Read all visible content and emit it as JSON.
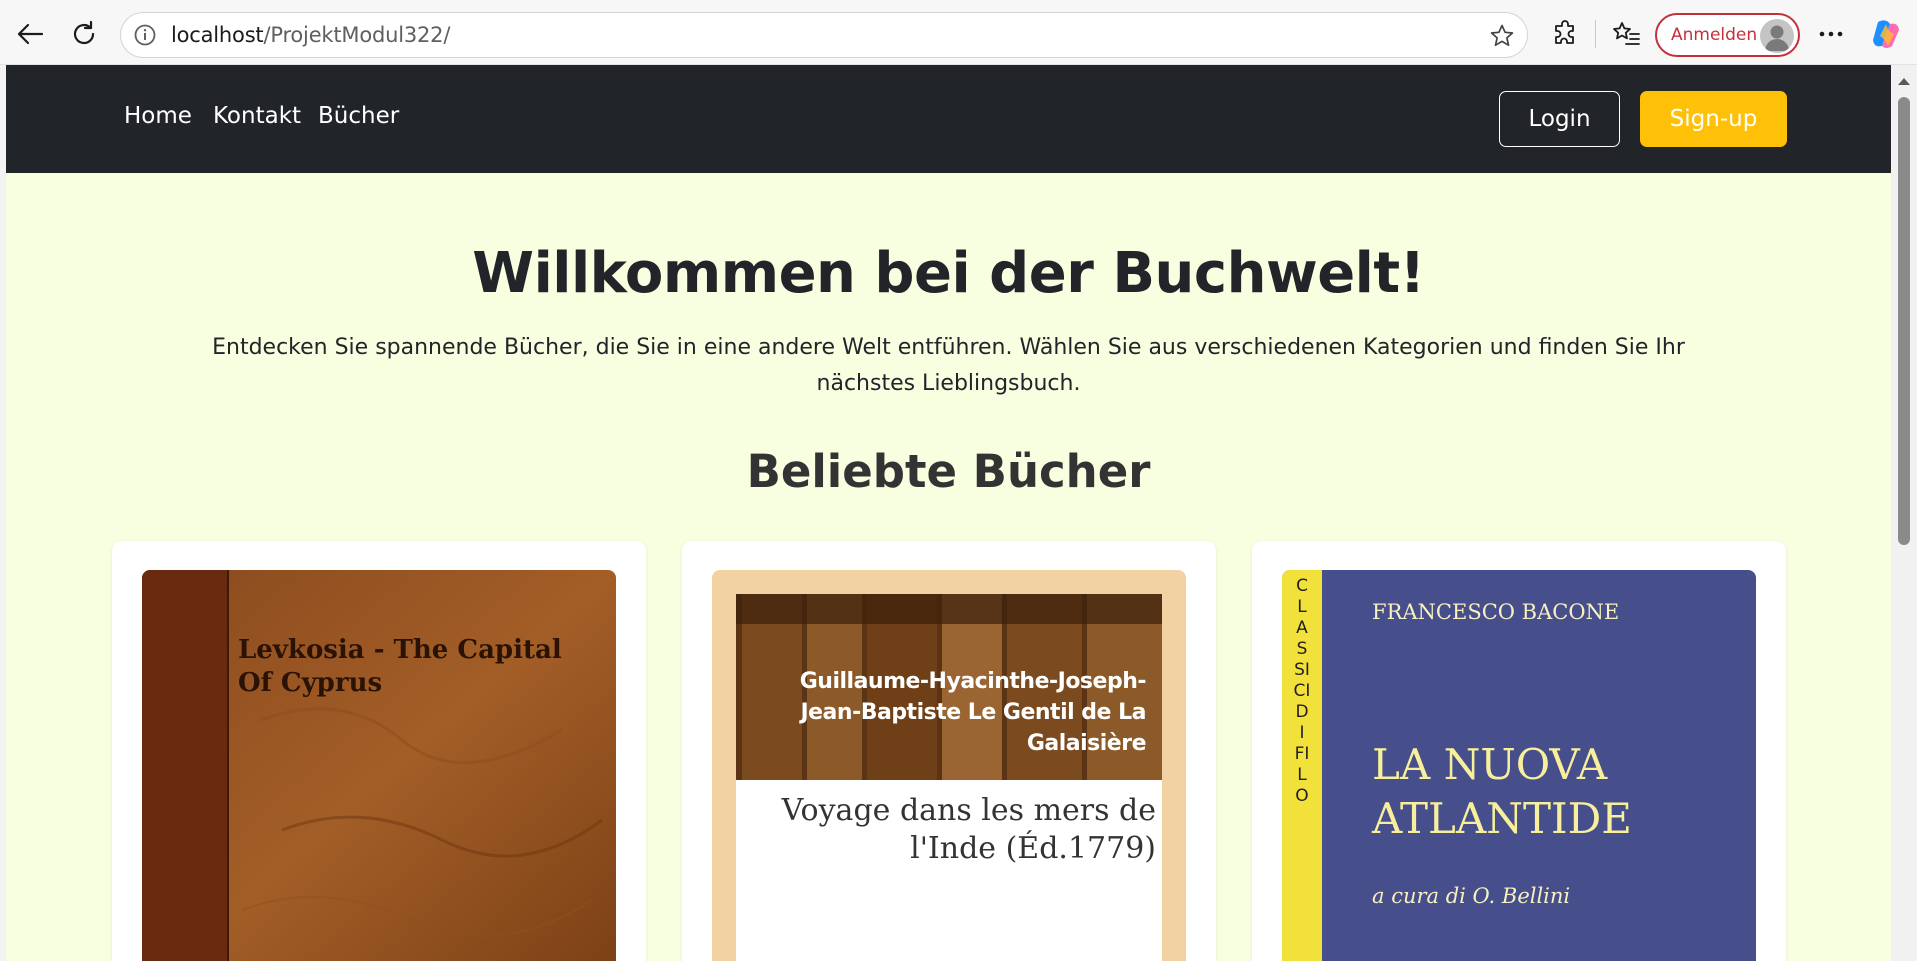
{
  "browser": {
    "url_host": "localhost",
    "url_path": "/ProjektModul322/",
    "signin_label": "Anmelden"
  },
  "navbar": {
    "links": [
      "Home",
      "Kontakt",
      "Bücher"
    ],
    "login_label": "Login",
    "signup_label": "Sign-up"
  },
  "hero": {
    "title": "Willkommen bei der Buchwelt!",
    "text": "Entdecken Sie spannende Bücher, die Sie in eine andere Welt entführen. Wählen Sie aus verschiedenen Kategorien und finden Sie Ihr nächstes Lieblingsbuch."
  },
  "section": {
    "title": "Beliebte Bücher"
  },
  "books": [
    {
      "cover_title_line1": "Levkosia - The Capital",
      "cover_title_line2": "Of Cyprus"
    },
    {
      "cover_author_line1": "Guillaume-Hyacinthe-Joseph-",
      "cover_author_line2": "Jean-Baptiste Le Gentil de La",
      "cover_author_line3": "Galaisière",
      "cover_title_line1": "Voyage dans les mers de",
      "cover_title_line2": "l'Inde (Éd.1779)"
    },
    {
      "cover_author": "FRANCESCO BACONE",
      "cover_title_line1": "LA NUOVA",
      "cover_title_line2": "ATLANTIDE",
      "cover_editor": "a cura di O. Bellini",
      "cover_spine": "CLASSICI DI FILO"
    }
  ],
  "colors": {
    "navbar_bg": "#212529",
    "page_bg": "#f8ffe0",
    "signup_bg": "#ffc107",
    "signin_accent": "#c4303a"
  }
}
